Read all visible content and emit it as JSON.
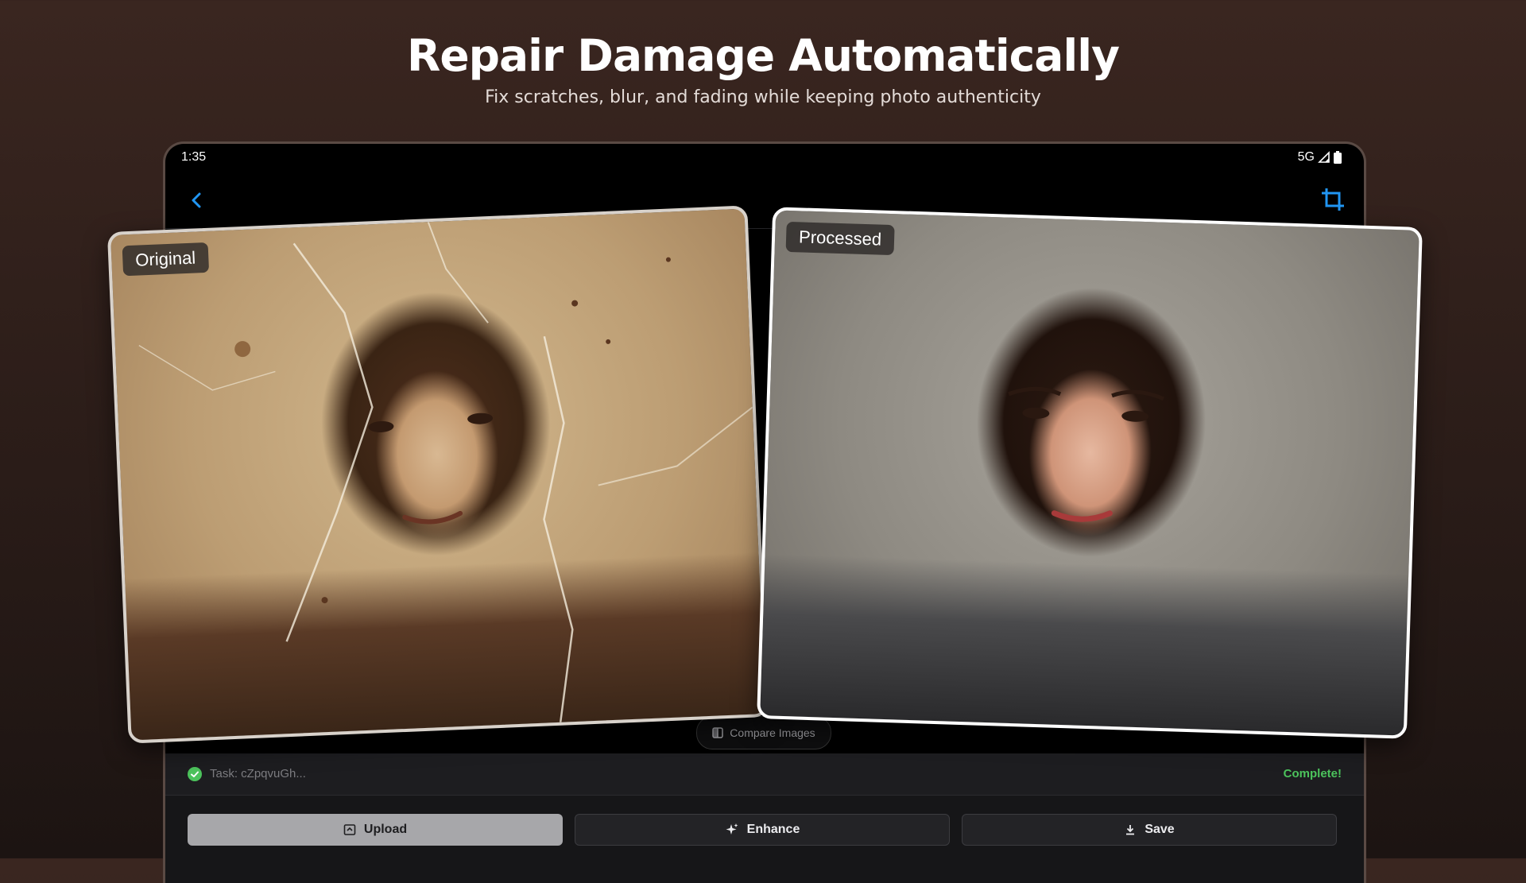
{
  "hero": {
    "title": "Repair Damage Automatically",
    "subtitle": "Fix scratches, blur, and fading while keeping photo authenticity"
  },
  "status_bar": {
    "time": "1:35",
    "network": "5G"
  },
  "app_bar": {
    "back_icon": "chevron-left-icon",
    "crop_icon": "crop-icon",
    "accent_color": "#2196f3"
  },
  "images": {
    "original_label": "Original",
    "processed_label": "Processed"
  },
  "compare": {
    "label": "Compare Images"
  },
  "task": {
    "label": "Task: cZpqvuGh...",
    "status": "Complete!",
    "status_color": "#4cc35c"
  },
  "actions": {
    "upload": "Upload",
    "enhance": "Enhance",
    "save": "Save"
  }
}
